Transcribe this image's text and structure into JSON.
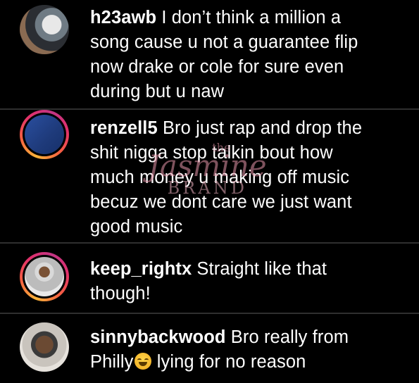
{
  "colors": {
    "background": "#000000",
    "text": "#ffffff",
    "divider": "#2f2f2f",
    "story_ring": "#e1306c"
  },
  "comments": [
    {
      "username": "h23awb",
      "avatar_icon": "user-avatar-icon",
      "has_story_ring": false,
      "lines": [
        " I don’t think a million a",
        "song cause u not a guarantee flip",
        "now drake or cole for sure even",
        "during but u naw"
      ]
    },
    {
      "username": "renzell5",
      "avatar_icon": "user-avatar-icon",
      "has_story_ring": true,
      "lines": [
        " Bro just rap and drop the",
        "shit nigga stop talkin bout how",
        "much money u making off music",
        "becuz we dont care we just want",
        "good music"
      ]
    },
    {
      "username": "keep_rightx",
      "avatar_icon": "user-avatar-icon",
      "has_story_ring": true,
      "lines": [
        " Straight like that",
        "though!"
      ]
    },
    {
      "username": "sinnybackwood",
      "avatar_icon": "user-avatar-icon",
      "has_story_ring": false,
      "lines": [
        " Bro really from",
        "Philly",
        " lying for no reason"
      ],
      "emoji_icon": "face-with-tears-of-joy-emoji"
    }
  ],
  "watermark": {
    "top": "the",
    "main": "Jasmine",
    "sub": "BRAND"
  }
}
